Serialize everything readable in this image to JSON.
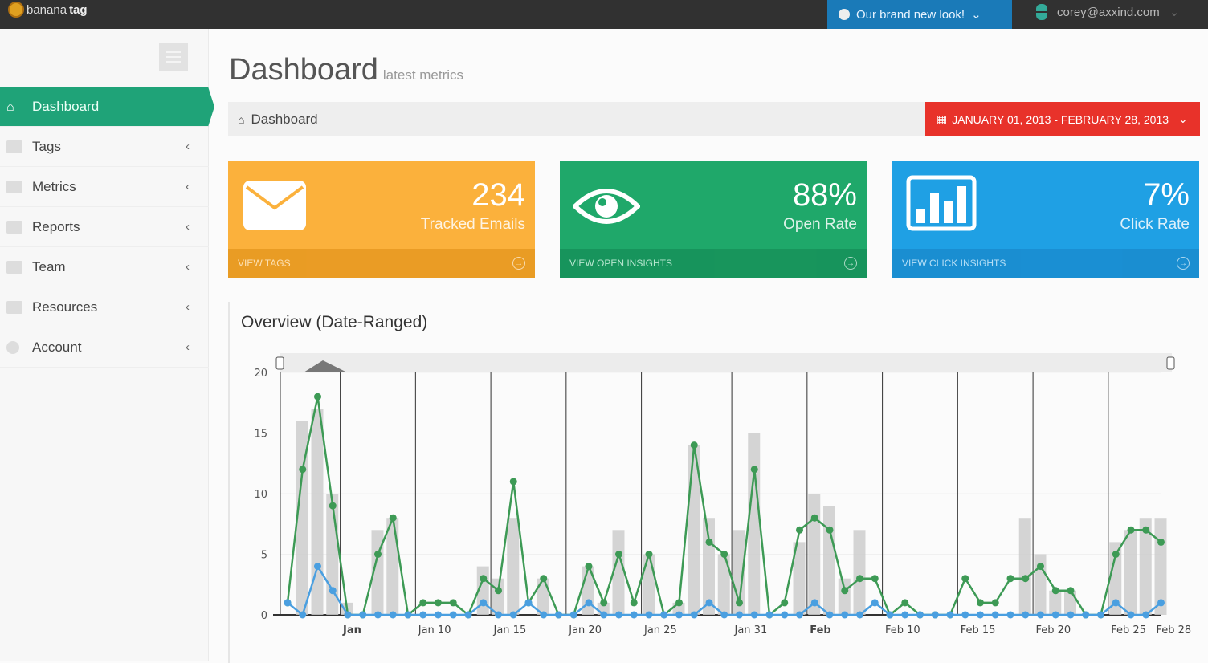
{
  "topbar": {
    "logo_a": "banana",
    "logo_b": "tag",
    "brand_text": "Our brand new look!",
    "user_email": "corey@axxind.com"
  },
  "sidebar": {
    "items": [
      {
        "label": "Dashboard",
        "icon": "home-icon",
        "active": true
      },
      {
        "label": "Tags",
        "icon": "tag-icon"
      },
      {
        "label": "Metrics",
        "icon": "chart-icon"
      },
      {
        "label": "Reports",
        "icon": "report-icon"
      },
      {
        "label": "Team",
        "icon": "team-icon"
      },
      {
        "label": "Resources",
        "icon": "book-icon"
      },
      {
        "label": "Account",
        "icon": "gear-icon"
      }
    ]
  },
  "header": {
    "title": "Dashboard",
    "subtitle": "latest metrics",
    "breadcrumb": "Dashboard",
    "date_range": "JANUARY 01, 2013 - FEBRUARY 28, 2013"
  },
  "cards": [
    {
      "value": "234",
      "label": "Tracked Emails",
      "link": "VIEW TAGS",
      "color": "#fbb13c"
    },
    {
      "value": "88%",
      "label": "Open Rate",
      "link": "VIEW OPEN INSIGHTS",
      "color": "#1fa86a"
    },
    {
      "value": "7%",
      "label": "Click Rate",
      "link": "VIEW CLICK INSIGHTS",
      "color": "#1fa0e4"
    }
  ],
  "chart_data": {
    "type": "bar+line",
    "title": "Overview (Date-Ranged)",
    "x_days": "Jan 1, 2013 - Feb 28, 2013 (daily)",
    "ylim": [
      0,
      20
    ],
    "yticks": [
      0,
      5,
      10,
      15,
      20
    ],
    "xticks": [
      {
        "day": 5,
        "label": "Jan",
        "bold": true
      },
      {
        "day": 10,
        "label": "Jan 10"
      },
      {
        "day": 15,
        "label": "Jan 15"
      },
      {
        "day": 20,
        "label": "Jan 20"
      },
      {
        "day": 25,
        "label": "Jan 25"
      },
      {
        "day": 31,
        "label": "Jan 31"
      },
      {
        "day": 36,
        "label": "Feb",
        "bold": true
      },
      {
        "day": 41,
        "label": "Feb 10"
      },
      {
        "day": 46,
        "label": "Feb 15"
      },
      {
        "day": 51,
        "label": "Feb 20"
      },
      {
        "day": 56,
        "label": "Feb 25"
      },
      {
        "day": 59,
        "label": "Feb 28"
      }
    ],
    "series": [
      {
        "type": "bar",
        "color": "#cccccc",
        "values": [
          0,
          16,
          17,
          10,
          1,
          0,
          7,
          8,
          0,
          0,
          0,
          0,
          0,
          4,
          3,
          8,
          0,
          3,
          0,
          0,
          4,
          1,
          7,
          0,
          5,
          0,
          1,
          14,
          8,
          5,
          7,
          15,
          0,
          0,
          6,
          10,
          9,
          3,
          7,
          0,
          0,
          0,
          0,
          0,
          0,
          0,
          0,
          0,
          0,
          8,
          5,
          2,
          2,
          0,
          0,
          6,
          7,
          8,
          8
        ]
      },
      {
        "type": "line",
        "color": "#3d9a55",
        "values": [
          1,
          12,
          18,
          9,
          0,
          0,
          5,
          8,
          0,
          1,
          1,
          1,
          0,
          3,
          2,
          11,
          1,
          3,
          0,
          0,
          4,
          1,
          5,
          1,
          5,
          0,
          1,
          14,
          6,
          5,
          1,
          12,
          0,
          1,
          7,
          8,
          7,
          2,
          3,
          3,
          0,
          1,
          0,
          0,
          0,
          3,
          1,
          1,
          3,
          3,
          4,
          2,
          2,
          0,
          0,
          5,
          7,
          7,
          6
        ]
      },
      {
        "type": "line",
        "color": "#4a9fe0",
        "values": [
          1,
          0,
          4,
          2,
          0,
          0,
          0,
          0,
          0,
          0,
          0,
          0,
          0,
          1,
          0,
          0,
          1,
          0,
          0,
          0,
          1,
          0,
          0,
          0,
          0,
          0,
          0,
          0,
          1,
          0,
          0,
          0,
          0,
          0,
          0,
          1,
          0,
          0,
          0,
          1,
          0,
          0,
          0,
          0,
          0,
          0,
          0,
          0,
          0,
          0,
          0,
          0,
          0,
          0,
          0,
          1,
          0,
          0,
          1
        ]
      }
    ]
  }
}
